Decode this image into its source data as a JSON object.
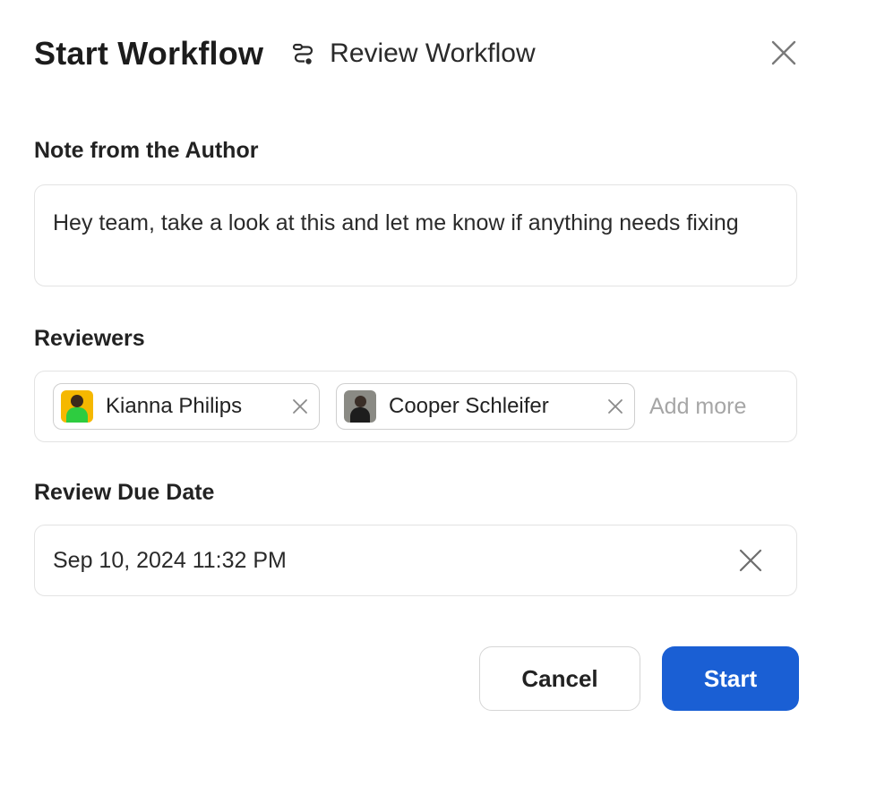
{
  "dialog": {
    "title": "Start Workflow",
    "workflow_name": "Review Workflow",
    "workflow_icon": "workflow-icon",
    "close_icon": "close-icon"
  },
  "note": {
    "label": "Note from the Author",
    "value": "Hey team, take a look at this and let me know if anything needs fixing"
  },
  "reviewers": {
    "label": "Reviewers",
    "items": [
      {
        "name": "Kianna Philips",
        "avatar": "avatar-yellow"
      },
      {
        "name": "Cooper Schleifer",
        "avatar": "avatar-dark"
      }
    ],
    "add_placeholder": "Add more"
  },
  "due_date": {
    "label": "Review Due Date",
    "value": "Sep 10, 2024 11:32 PM"
  },
  "actions": {
    "cancel_label": "Cancel",
    "start_label": "Start"
  },
  "colors": {
    "primary": "#1a5fd4",
    "border": "#e3e3e3",
    "placeholder": "#a6a6a6"
  }
}
